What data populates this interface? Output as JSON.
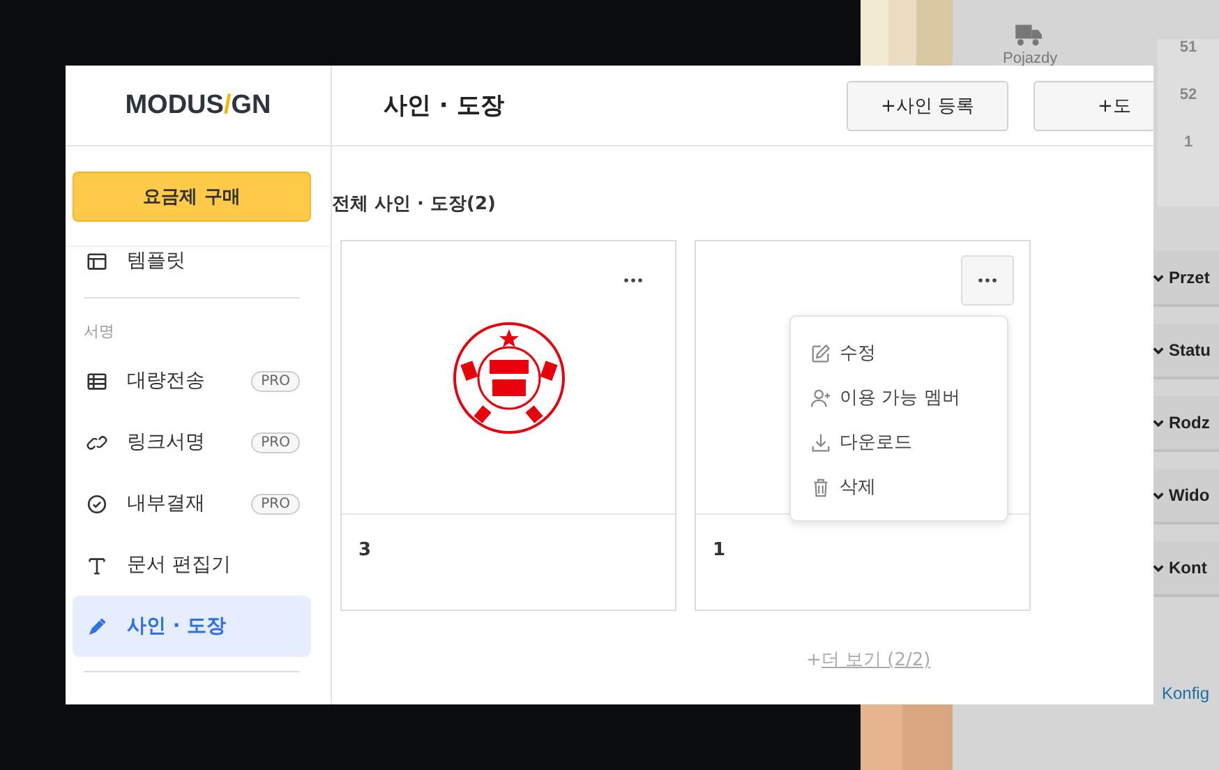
{
  "background_window": {
    "vehicles_label": "Pojazdy",
    "counts": [
      "51",
      "52",
      "1"
    ],
    "sections": [
      "Przet",
      "Statu",
      "Rodz",
      "Wido",
      "Kont"
    ],
    "config_link": "Konfig"
  },
  "window": {
    "logo": [
      "MODUS",
      "/",
      "GN"
    ],
    "title": "사인 · 도장",
    "header_buttons": [
      "+사인 등록",
      "+도"
    ]
  },
  "sidebar": {
    "purchase_button": "요금제 구매",
    "top_items": [
      {
        "label": "템플릿",
        "kind": "template",
        "selected": false
      }
    ],
    "sections": [
      {
        "heading": "서명",
        "items": [
          {
            "label": "대량전송",
            "kind": "table",
            "badge": "PRO",
            "selected": false
          },
          {
            "label": "링크서명",
            "kind": "link",
            "badge": "PRO",
            "selected": false
          },
          {
            "label": "내부결재",
            "kind": "check",
            "badge": "PRO",
            "selected": false
          },
          {
            "label": "문서 편집기",
            "kind": "text",
            "selected": false
          },
          {
            "label": "사인 · 도장",
            "kind": "pen",
            "selected": true
          }
        ]
      }
    ]
  },
  "main": {
    "heading": "전체 사인 · 도장(2)",
    "cards": [
      {
        "name": "3",
        "has_image": true,
        "menu_open": false
      },
      {
        "name": "1",
        "has_image": false,
        "menu_open": true
      }
    ],
    "menu": [
      {
        "label": "수정",
        "kind": "edit"
      },
      {
        "label": "이용 가능 멤버",
        "kind": "member"
      },
      {
        "label": "다운로드",
        "kind": "download"
      },
      {
        "label": "삭제",
        "kind": "trash"
      }
    ],
    "more_link": {
      "plus": "+",
      "label": "더 보기 (2/2)"
    }
  }
}
